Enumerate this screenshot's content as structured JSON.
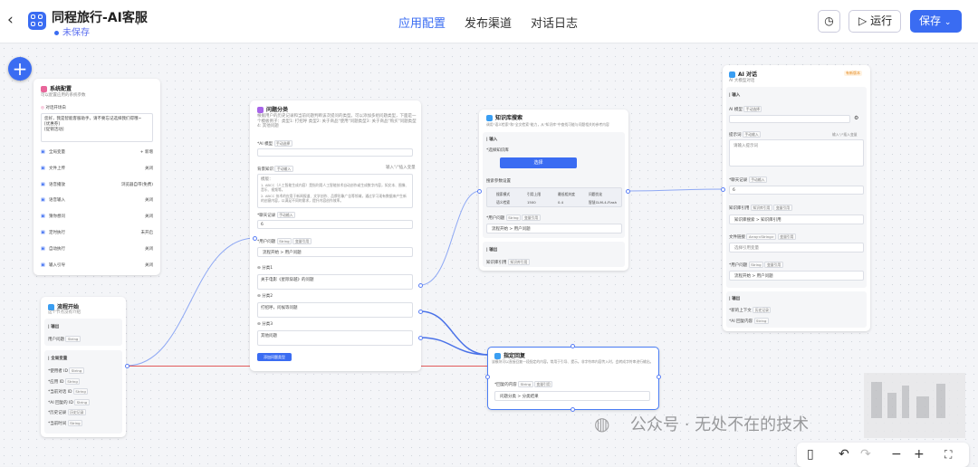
{
  "app": {
    "title": "同程旅行-AI客服",
    "status": "未保存"
  },
  "tabs": [
    {
      "label": "应用配置"
    },
    {
      "label": "发布渠道"
    },
    {
      "label": "对话日志"
    }
  ],
  "toolbar": {
    "run": "运行",
    "save": "保存"
  },
  "colors": {
    "accent": "#3a6cf2",
    "edge": "#7f9ff2",
    "warn": "#e58a1f"
  },
  "nodes": {
    "system": {
      "title": "系统配置",
      "desc": "可以配置应用的系统参数",
      "welcome_label": "对话开场白",
      "welcome_text": [
        "您好，我是智能客服助手，请不要忘记选择我们得哦~",
        "[优惠券]",
        "[促销活动]"
      ],
      "settings": [
        {
          "label": "全局变量",
          "value": "+ 新增"
        },
        {
          "label": "文件上传",
          "value": "关闭"
        },
        {
          "label": "语音播放",
          "value": "浏览器自带(免费)"
        },
        {
          "label": "语音输入",
          "value": "关闭"
        },
        {
          "label": "猜你想问",
          "value": "关闭"
        },
        {
          "label": "定时执行",
          "value": "未开启"
        },
        {
          "label": "自动执行",
          "value": "关闭"
        },
        {
          "label": "输入引导",
          "value": "关闭"
        }
      ]
    },
    "start": {
      "title": "流程开始",
      "desc": "这个节点没有介绍",
      "output_label": "输出",
      "output_field": "用户问题",
      "output_type": "String",
      "global_label": "全局变量",
      "globals": [
        {
          "name": "使用者 ID",
          "type": "String"
        },
        {
          "name": "应用 ID",
          "type": "String"
        },
        {
          "name": "当前对话 ID",
          "type": "String"
        },
        {
          "name": "AI 回复的 ID",
          "type": "String"
        },
        {
          "name": "历史记录",
          "type": "历史记录"
        },
        {
          "name": "当前时间",
          "type": "String"
        }
      ]
    },
    "classify": {
      "title": "问题分类",
      "desc": "根据用户的历史记录和当前问题判断该次提问的类型。可以添加多组问题类型，下面是一个模板例子：类型1: 打招呼 类型2: 关于商品\"使用\"问题类型3: 关于商品\"购买\"问题类型4: 其他问题",
      "model_label": "AI 模型",
      "model_tag": "手动选择",
      "bg_label": "背景知识",
      "bg_tag": "手动输入",
      "bg_var": "输入\"/\"插入变量",
      "bg_text": [
        "模版：",
        "1. ABCC（人工智能生成内容）是指利用人工智能技术自动创作或生成数字内容，如文本、图像、音乐、视频等。",
        "2. ABCC 技术的应用于新闻报道、文学创作、品牌形象广告等领域，通过学习现有数据来产生新的创意内容，以满足不同的需求，提升内容创作效率。"
      ],
      "history_label": "聊天记录",
      "history_tag": "手动输入",
      "history_value": "6",
      "question_label": "用户问题",
      "question_type": "String",
      "question_tag": "变量引用",
      "question_ref": "流程开始 > 用户问题",
      "categories": [
        {
          "label": "分类1",
          "text": "关于电影《星际穿越》的问题"
        },
        {
          "label": "分类2",
          "text": "打招呼，问候等问题"
        },
        {
          "label": "分类3",
          "text": "其他问题"
        }
      ],
      "add_button": "添加问题类型"
    },
    "knowledge": {
      "title": "知识库搜索",
      "desc": "调用\"语义检索\"和\"全文检索\"能力，从\"知识库\"中查找可能与问题相关的参考内容",
      "input_label": "输入",
      "kb_label": "选择知识库",
      "kb_button": "选择",
      "params_label": "搜索参数设置",
      "param_headers": [
        "搜索模式",
        "引用上限",
        "最低相关度",
        "问题优化"
      ],
      "param_values": [
        "语义检索",
        "1500",
        "0.4",
        "智慧GLM-4-Flash"
      ],
      "question_label": "用户问题",
      "question_type": "String",
      "question_tag": "变量引用",
      "question_ref": "流程开始 > 用户问题",
      "output_label": "输出",
      "output_field": "知识库引用",
      "output_type": "知识库引用"
    },
    "reply": {
      "title": "指定回复",
      "desc": "该模块可以直接回复一段指定的内容。常用于引导、提示。非字符串内容传入时，会转成字符串进行输出。",
      "content_label": "回复的内容",
      "content_type": "String",
      "content_tag": "变量引用",
      "content_ref": "问题分类 > 分类结果"
    },
    "ai": {
      "title": "AI 对话",
      "badge": "有新版本",
      "desc": "AI 大模型对话",
      "input_label": "输入",
      "model_label": "AI 模型",
      "model_tag": "手动选择",
      "prompt_label": "提示词",
      "prompt_tag": "手动输入",
      "prompt_var": "输入\"/\"插入变量",
      "prompt_placeholder": "请输入提示词",
      "history_label": "聊天记录",
      "history_tag": "手动输入",
      "history_value": "6",
      "kb_label": "知识库引用",
      "kb_type": "知识库引用",
      "kb_tag": "变量引用",
      "kb_ref": "知识库搜索 > 知识库引用",
      "file_label": "文件链接",
      "file_type": "Array<String>",
      "file_tag": "变量引用",
      "file_placeholder": "选择引用变量",
      "question_label": "用户问题",
      "question_type": "String",
      "question_tag": "变量引用",
      "question_ref": "流程开始 > 用户问题",
      "output_label": "输出",
      "outputs": [
        {
          "name": "新的上下文",
          "type": "历史记录"
        },
        {
          "name": "AI 回复内容",
          "type": "String"
        }
      ]
    }
  },
  "watermark": "公众号 · 无处不在的技术",
  "zoom": {
    "minus": "−",
    "plus": "+"
  }
}
